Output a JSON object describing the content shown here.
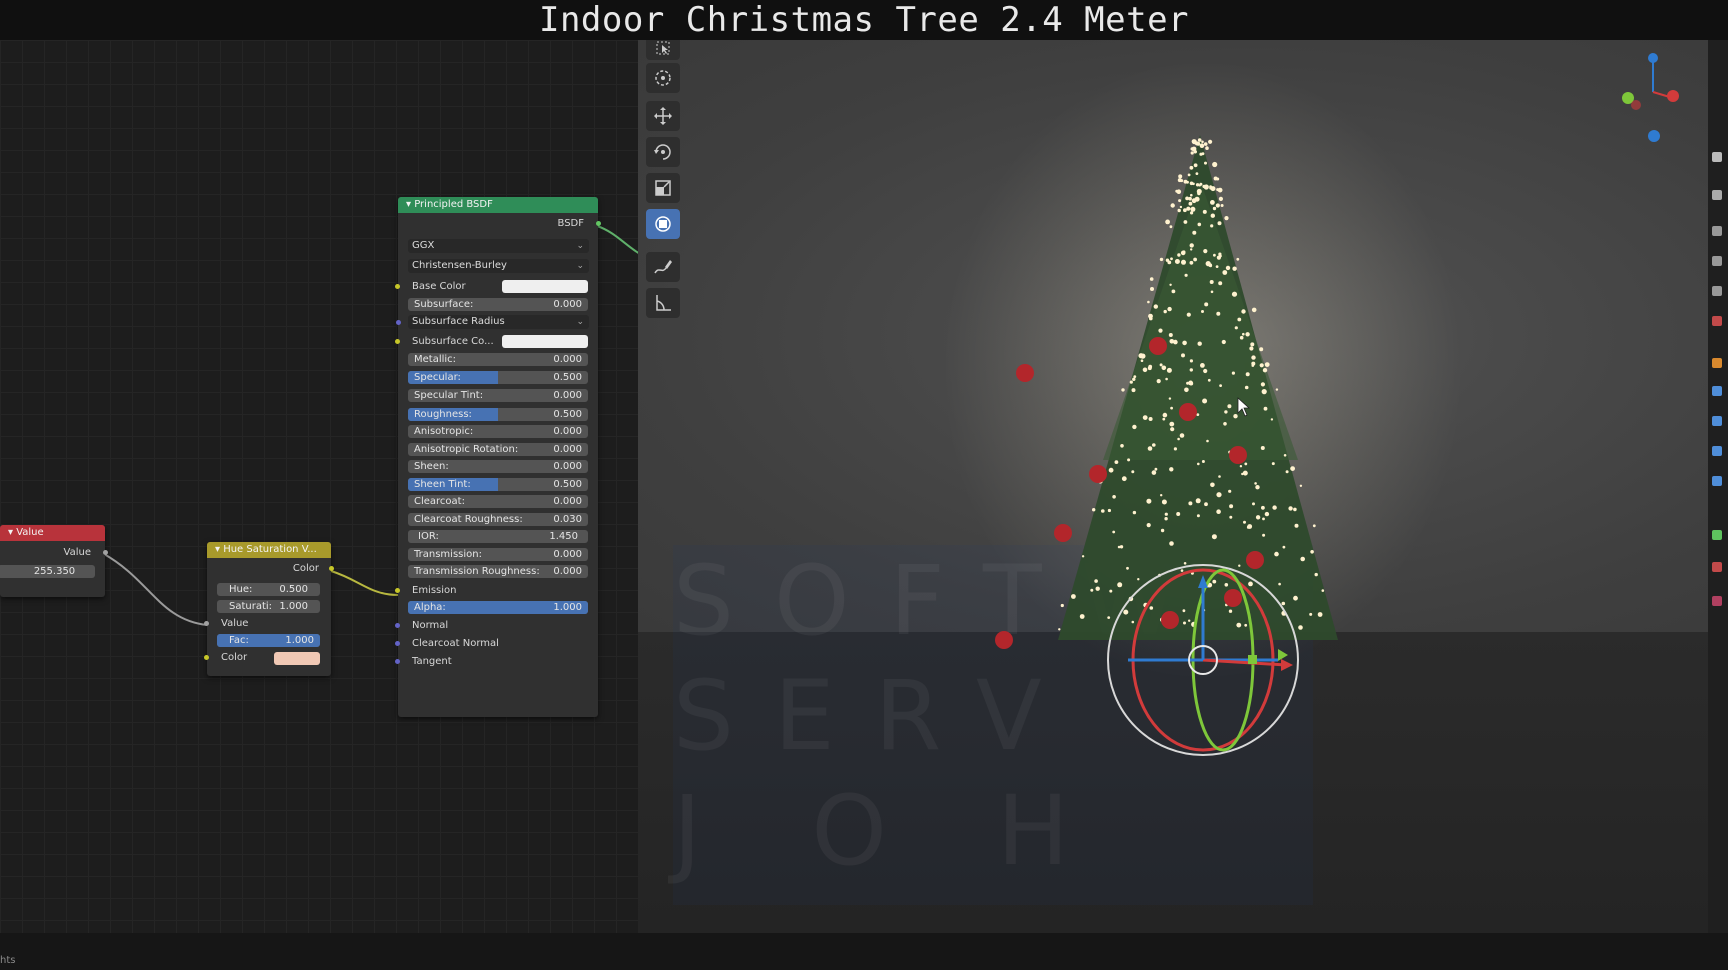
{
  "title": "Indoor Christmas Tree 2.4 Meter",
  "node_editor": {
    "value_node": {
      "header": "Value",
      "output_label": "Value",
      "value": "255.350",
      "header_color": "#b8333b"
    },
    "hue_saturation_node": {
      "header": "Hue Saturation V...",
      "output_label": "Color",
      "header_color": "#a89a2b",
      "hue_label": "Hue:",
      "hue_value": "0.500",
      "saturation_label": "Saturati:",
      "saturation_value": "1.000",
      "value_label": "Value",
      "fac_label": "Fac:",
      "fac_value": "1.000",
      "color_label": "Color",
      "color_swatch": "#f0c8b4"
    },
    "principled_node": {
      "header": "Principled BSDF",
      "header_color": "#2f8d58",
      "output_label": "BSDF",
      "distribution": "GGX",
      "subsurface_method": "Christensen-Burley",
      "base_color_label": "Base Color",
      "subsurface_label": "Subsurface:",
      "subsurface_value": "0.000",
      "subsurface_radius_label": "Subsurface Radius",
      "subsurface_color_label": "Subsurface Co...",
      "metallic_label": "Metallic:",
      "metallic_value": "0.000",
      "specular_label": "Specular:",
      "specular_value": "0.500",
      "specular_tint_label": "Specular Tint:",
      "specular_tint_value": "0.000",
      "roughness_label": "Roughness:",
      "roughness_value": "0.500",
      "anisotropic_label": "Anisotropic:",
      "anisotropic_value": "0.000",
      "anisotropic_rotation_label": "Anisotropic Rotation:",
      "anisotropic_rotation_value": "0.000",
      "sheen_label": "Sheen:",
      "sheen_value": "0.000",
      "sheen_tint_label": "Sheen Tint:",
      "sheen_tint_value": "0.500",
      "clearcoat_label": "Clearcoat:",
      "clearcoat_value": "0.000",
      "clearcoat_roughness_label": "Clearcoat Roughness:",
      "clearcoat_roughness_value": "0.030",
      "ior_label": "IOR:",
      "ior_value": "1.450",
      "transmission_label": "Transmission:",
      "transmission_value": "0.000",
      "transmission_roughness_label": "Transmission Roughness:",
      "transmission_roughness_value": "0.000",
      "emission_label": "Emission",
      "alpha_label": "Alpha:",
      "alpha_value": "1.000",
      "normal_label": "Normal",
      "clearcoat_normal_label": "Clearcoat Normal",
      "tangent_label": "Tangent",
      "fill_fractions": {
        "specular": 0.5,
        "roughness": 0.5,
        "sheen_tint": 0.5,
        "alpha": 1.0,
        "fac": 1.0
      }
    }
  },
  "viewport": {
    "watermark_lines": [
      "SOFTW",
      "SERV",
      "JOH"
    ],
    "tools": [
      "select-box",
      "cursor",
      "move",
      "rotate",
      "scale",
      "transform",
      "annotate",
      "measure"
    ],
    "active_tool": "transform"
  },
  "status_bar": {
    "text": "hts"
  },
  "colors": {
    "accent": "#4772b3",
    "tree_green": "#2d4a2a",
    "ornament_red": "#b3262b",
    "light_glow": "#fff2cf"
  }
}
